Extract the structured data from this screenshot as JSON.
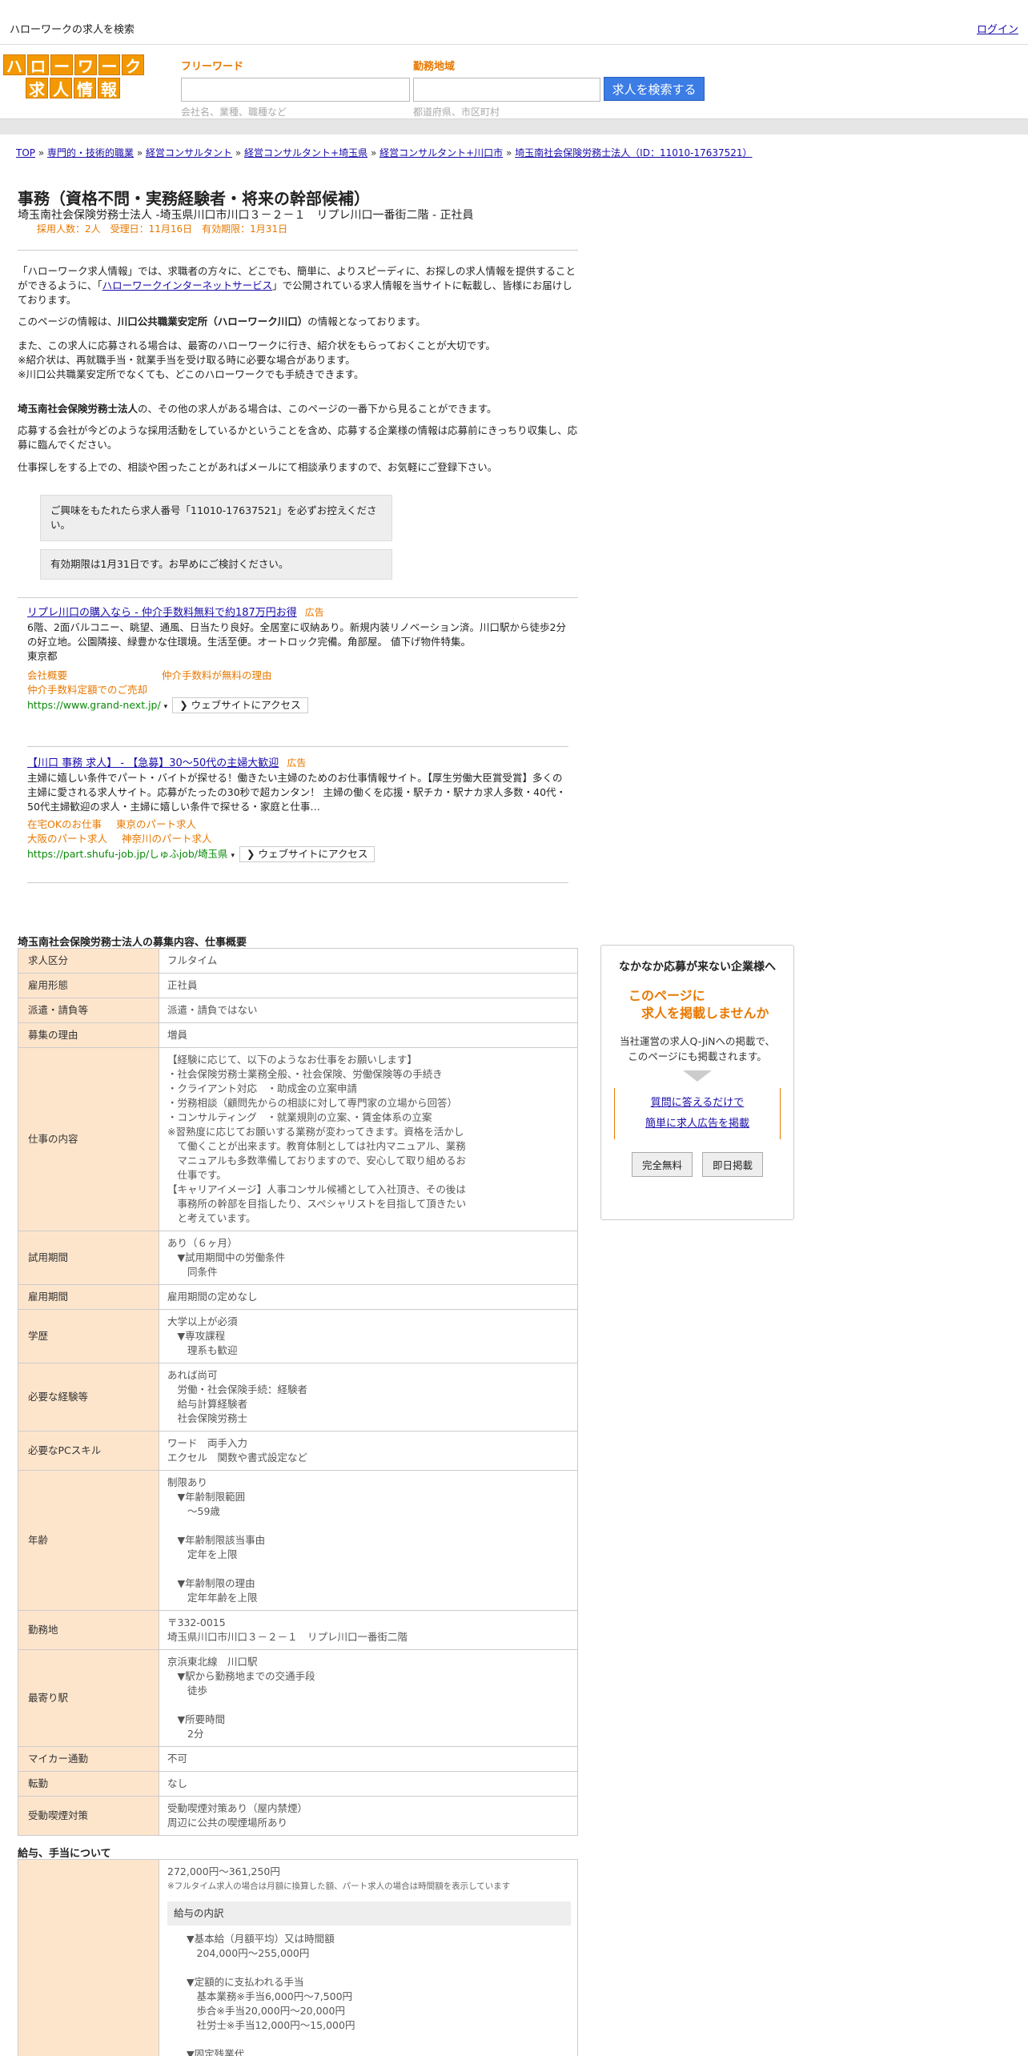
{
  "header": {
    "title": "ハローワークの求人を検索",
    "login": "ログイン"
  },
  "logo": {
    "row1": [
      "ハ",
      "ロ",
      "ー",
      "ワ",
      "ー",
      "ク"
    ],
    "row2": [
      "求",
      "人",
      "情",
      "報"
    ]
  },
  "search": {
    "freeword_label": "フリーワード",
    "freeword_placeholder": "会社名、業種、職種など",
    "area_label": "勤務地域",
    "area_placeholder": "都道府県、市区町村",
    "button": "求人を検索する"
  },
  "breadcrumb": [
    "TOP",
    "専門的・技術的職業",
    "経営コンサルタント",
    "経営コンサルタント+埼玉県",
    "経営コンサルタント+川口市",
    "埼玉南社会保険労務士法人（ID：11010-17637521）"
  ],
  "breadcrumb_sep": "»",
  "job": {
    "title": "事務（資格不問・実務経験者・将来の幹部候補）",
    "subtitle": "埼玉南社会保険労務士法人 -埼玉県川口市川口３－２－１　リプレ川口一番街二階 - 正社員",
    "meta": "採用人数：2人　受理日：11月16日　有効期限：1月31日"
  },
  "intro": {
    "p1a": "「ハローワーク求人情報」では、求職者の方々に、どこでも、簡単に、よりスピーディに、お探しの求人情報を提供することができるように、「",
    "p1link": "ハローワークインターネットサービス",
    "p1b": "」で公開されている求人情報を当サイトに転載し、皆様にお届けしております。",
    "p2a": "このページの情報は、",
    "p2b": "川口公共職業安定所（ハローワーク川口）",
    "p2c": "の情報となっております。",
    "p3": "また、この求人に応募される場合は、最寄のハローワークに行き、紹介状をもらっておくことが大切です。",
    "p4": "※紹介状は、再就職手当・就業手当を受け取る時に必要な場合があります。",
    "p5": "※川口公共職業安定所でなくても、どこのハローワークでも手続きできます。",
    "p6a": "埼玉南社会保険労務士法人",
    "p6b": "の、その他の求人がある場合は、このページの一番下から見ることができます。",
    "p7": "応募する会社が今どのような採用活動をしているかということを含め、応募する企業様の情報は応募前にきっちり収集し、応募に臨んでください。",
    "p8": "仕事探しをする上での、相談や困ったことがあればメールにて相談承りますので、お気軽にご登録下さい。"
  },
  "notes": {
    "n1": "ご興味をもたれたら求人番号「11010-17637521」を必ずお控えください。",
    "n2": "有効期限は1月31日です。お早めにご検討ください。"
  },
  "ads": [
    {
      "title": "リプレ川口の購入なら - 仲介手数料無料で約187万円お得",
      "badge": "広告",
      "desc": "6階、2面バルコニー、眺望、通風、日当たり良好。全居室に収納あり。新規内装リノベーション済。川口駅から徒歩2分の好立地。公園隣接、緑豊かな住環境。生活至便。オートロック完備。角部屋。 値下げ物件特集。",
      "region": "東京都",
      "links": [
        "会社概要",
        "仲介手数料が無料の理由",
        "仲介手数料定額でのご売却"
      ],
      "url": "https://www.grand-next.jp/",
      "visit": "ウェブサイトにアクセス"
    },
    {
      "title": "【川口 事務 求人】 - 【急募】30～50代の主婦大歓迎",
      "badge": "広告",
      "desc": "主婦に嬉しい条件でパート・バイトが探せる！働きたい主婦のためのお仕事情報サイト。【厚生労働大臣賞受賞】多くの主婦に愛される求人サイト。応募がたったの30秒で超カンタン！ 主婦の働くを応援・駅チカ・駅ナカ求人多数・40代・50代主婦歓迎の求人・主婦に嬉しい条件で探せる・家庭と仕事…",
      "links": [
        "在宅OKのお仕事",
        "東京のパート求人",
        "大阪のパート求人",
        "神奈川のパート求人"
      ],
      "url": "https://part.shufu-job.jp/しゅふjob/埼玉県",
      "visit": "ウェブサイトにアクセス"
    }
  ],
  "section1": "埼玉南社会保険労務士法人の募集内容、仕事概要",
  "rows": [
    {
      "k": "求人区分",
      "v": "フルタイム"
    },
    {
      "k": "雇用形態",
      "v": "正社員"
    },
    {
      "k": "派遣・請負等",
      "v": "派遣・請負ではない"
    },
    {
      "k": "募集の理由",
      "v": "増員"
    },
    {
      "k": "仕事の内容",
      "v": "【経験に応じて、以下のようなお仕事をお願いします】\n・社会保険労務士業務全般、・社会保険、労働保険等の手続き\n・クライアント対応　・助成金の立案申請\n・労務相談（顧問先からの相談に対して専門家の立場から回答）\n・コンサルティング　・就業規則の立案、・賃金体系の立案\n※習熟度に応じてお願いする業務が変わってきます。資格を活かし\n　て働くことが出来ます。教育体制としては社内マニュアル、業務\n　マニュアルも多数準備しておりますので、安心して取り組めるお\n　仕事です。\n【キャリアイメージ】人事コンサル候補として入社頂き、その後は\n　事務所の幹部を目指したり、スペシャリストを目指して頂きたい\n　と考えています。"
    },
    {
      "k": "試用期間",
      "v": "あり（６ヶ月）\n　▼試用期間中の労働条件\n　　同条件"
    },
    {
      "k": "雇用期間",
      "v": "雇用期間の定めなし"
    },
    {
      "k": "学歴",
      "v": "大学以上が必須\n　▼専攻課程\n　　理系も歓迎"
    },
    {
      "k": "必要な経験等",
      "v": "あれば尚可\n　労働・社会保険手続：経験者\n　給与計算経験者\n　社会保険労務士"
    },
    {
      "k": "必要なPCスキル",
      "v": "ワード　両手入力\nエクセル　関数や書式設定など"
    },
    {
      "k": "年齢",
      "v": "制限あり\n　▼年齢制限範囲\n　　〜59歳\n\n　▼年齢制限該当事由\n　　定年を上限\n\n　▼年齢制限の理由\n　　定年年齢を上限"
    },
    {
      "k": "勤務地",
      "v": "〒332-0015\n埼玉県川口市川口３－２－１　リプレ川口一番街二階"
    },
    {
      "k": "最寄り駅",
      "v": "京浜東北線　川口駅\n　▼駅から勤務地までの交通手段\n　　徒歩\n\n　▼所要時間\n　　2分"
    },
    {
      "k": "マイカー通勤",
      "v": "不可"
    },
    {
      "k": "転勤",
      "v": "なし"
    },
    {
      "k": "受動喫煙対策",
      "v": "受動喫煙対策あり（屋内禁煙）\n周辺に公共の喫煙場所あり"
    }
  ],
  "section2": "給与、手当について",
  "salary": {
    "range": "272,000円〜361,250円",
    "note": "※フルタイム求人の場合は月額に換算した額、パート求人の場合は時間額を表示しています",
    "breakdown": "給与の内訳",
    "items": "▼基本給（月額平均）又は時間額\n　204,000円〜255,000円\n\n▼定額的に支払われる手当\n　基本業務※手当6,000円〜7,500円\n　歩合※手当20,000円〜20,000円\n　社労士※手当12,000円〜15,000円\n\n▼固定残業代\n　あり"
  },
  "side": {
    "title": "なかなか応募が来ない企業様へ",
    "o1": "このページに",
    "o2": "　求人を掲載しませんか",
    "desc1": "当社運営の求人Q-JiNへの掲載で、",
    "desc2": "このページにも掲載されます。",
    "link1": "質問に答えるだけで",
    "link2": "簡単に求人広告を掲載",
    "btn1": "完全無料",
    "btn2": "即日掲載"
  }
}
